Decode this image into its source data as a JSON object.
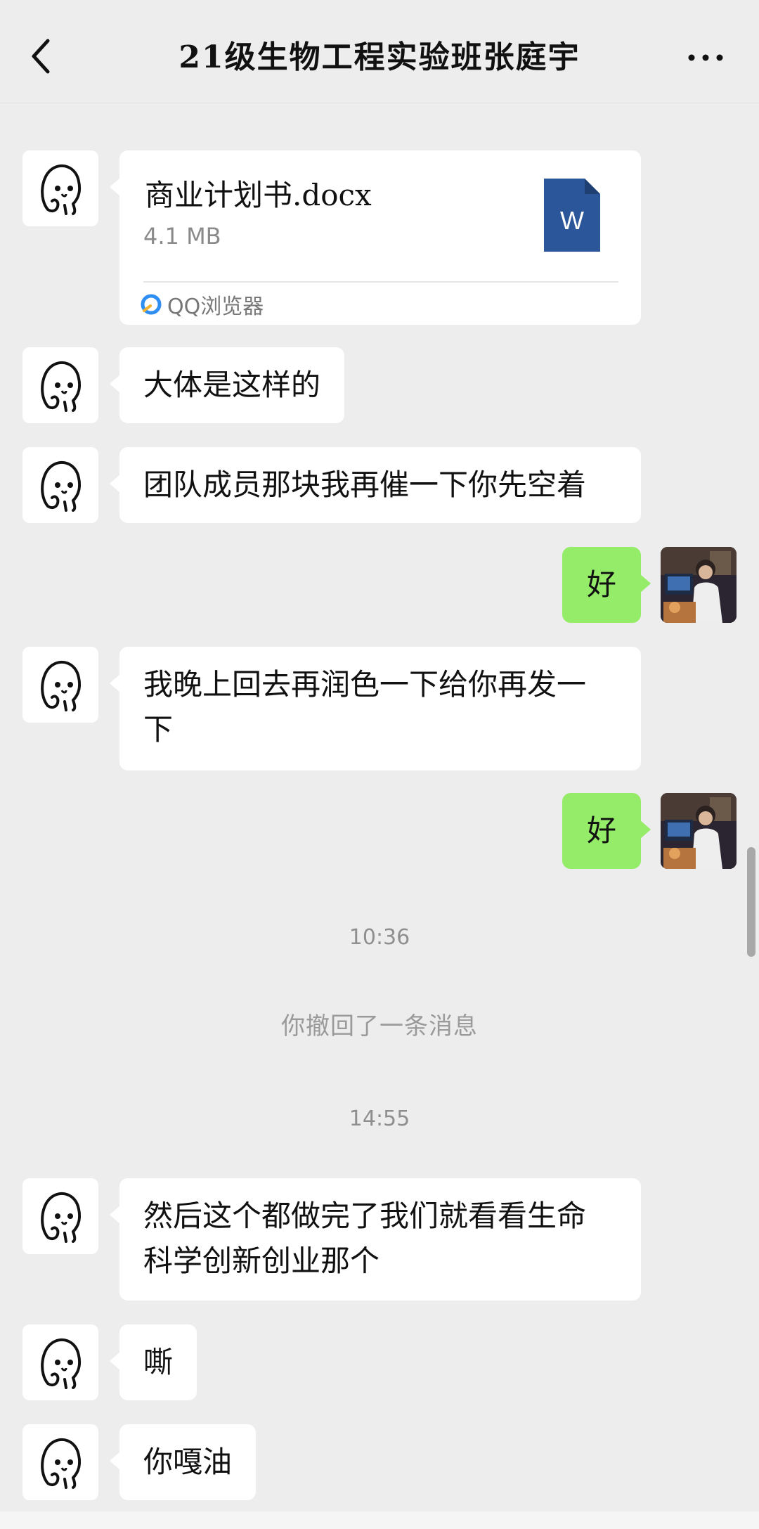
{
  "header": {
    "title": "21级生物工程实验班张庭宇",
    "back_icon": "chevron-left-icon",
    "more_icon": "ellipsis-icon"
  },
  "messages": {
    "file": {
      "name": "商业计划书.docx",
      "size": "4.1 MB",
      "source": "QQ浏览器",
      "icon": "word-document-icon"
    },
    "m1": "大体是这样的",
    "m2": "团队成员那块我再催一下你先空着",
    "m3": "好",
    "m4_line1": "我晚上回去再润色一下给你再发一",
    "m4_line2": "下",
    "m5": "好",
    "m6_line1": "然后这个都做完了我们就看看生命",
    "m6_line2": "科学创新创业那个",
    "m7": "嘶",
    "m8": "你嘎油"
  },
  "system": {
    "time1": "10:36",
    "recall_note": "你撤回了一条消息",
    "time2": "14:55"
  },
  "colors": {
    "background": "#ededed",
    "bubble_in": "#ffffff",
    "bubble_out": "#95ec69",
    "word_blue": "#2b579a"
  }
}
